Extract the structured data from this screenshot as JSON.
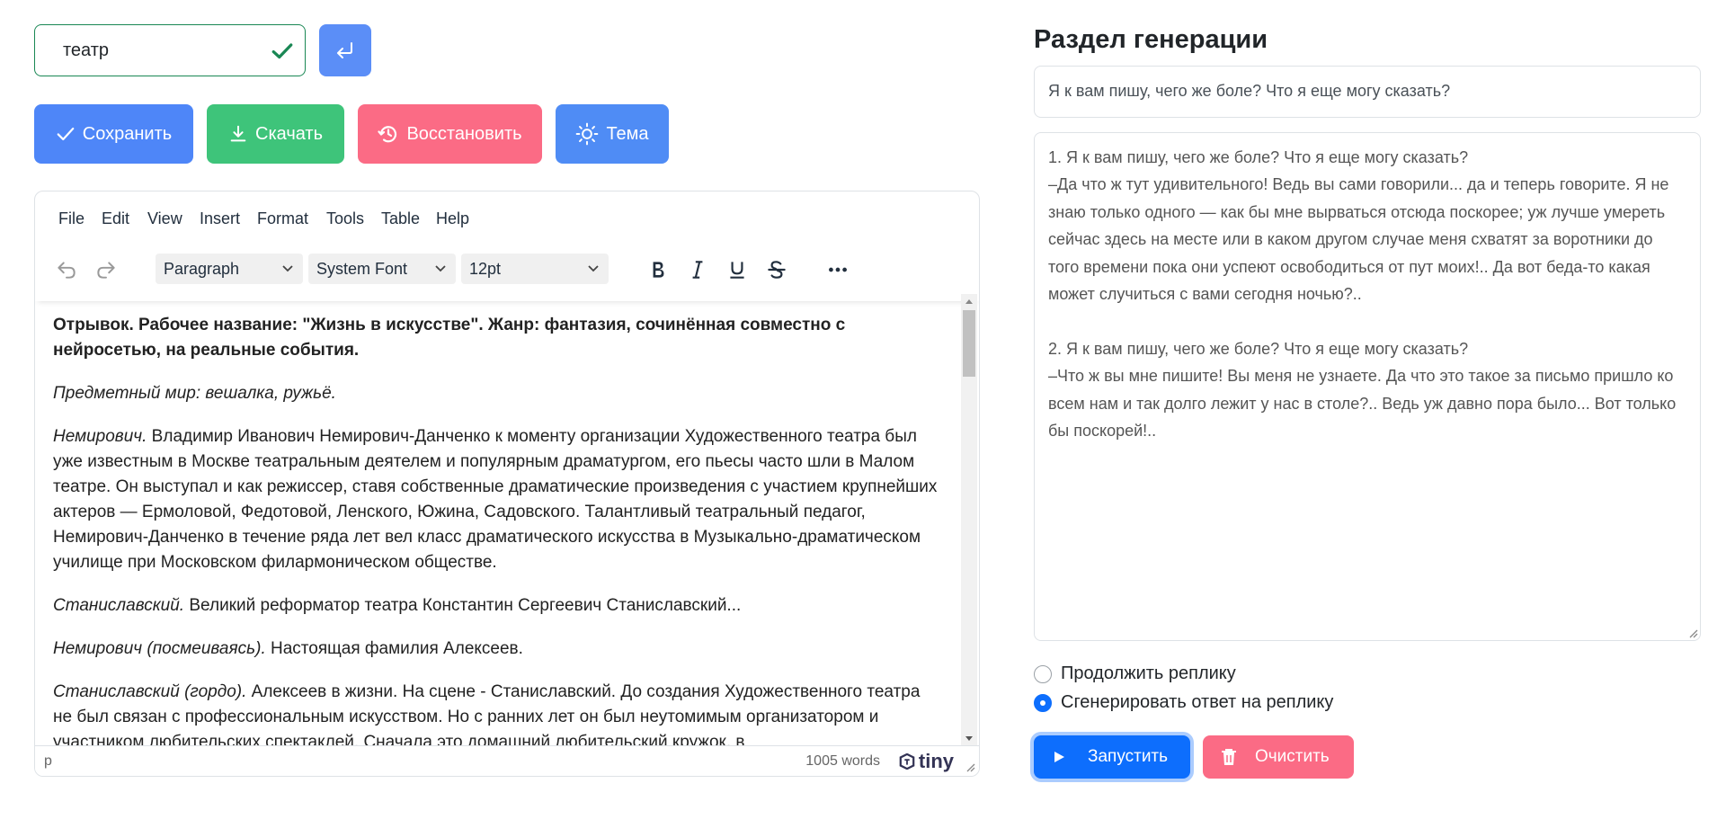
{
  "search": {
    "value": "театр"
  },
  "toolbar": {
    "save_label": "Сохранить",
    "download_label": "Скачать",
    "restore_label": "Восстановить",
    "theme_label": "Тема"
  },
  "editor": {
    "menu": [
      "File",
      "Edit",
      "View",
      "Insert",
      "Format",
      "Tools",
      "Table",
      "Help"
    ],
    "block_format": "Paragraph",
    "font_family": "System Font",
    "font_size": "12pt",
    "content": {
      "heading": "Отрывок. Рабочее название: \"Жизнь в искусстве\". Жанр: фантазия, сочинённая совместно с нейросетью, на реальные события.",
      "p1": "Предметный мир: вешалка, ружьё.",
      "p2_speaker": "Немирович.",
      "p2_text": " Владимир Иванович Немирович-Данченко к моменту организации Художественного театра был уже известным в Москве театральным деятелем и популярным драматургом, его пьесы часто шли в Малом театре. Он выступал и как режиссер, ставя собственные драматические произведения с участием крупнейших актеров — Ермоловой, Федотовой, Ленского, Южина, Садовского. Талантливый театральный педагог, Немирович-Данченко в течение ряда лет вел класс драматического искусства в Музыкально-драматическом училище при Московском филармоническом обществе.",
      "p3_speaker": "Станиславский.",
      "p3_text": " Великий реформатор театра Константин Сергеевич Станиславский...",
      "p4_speaker": "Немирович (посмеиваясь).",
      "p4_text": " Настоящая фамилия Алексеев.",
      "p5_speaker": "Станиславский (гордо).",
      "p5_text": " Алексеев в жизни. На сцене - Станиславский. До создания Художественного театра не был связан с профессиональным искусством. Но с ранних лет он был неутомимым организатором и участником любительских спектаклей. Сначала это домашний любительский кружок, в"
    },
    "status": {
      "path": "p",
      "word_count": "1005 words",
      "brand": "tiny"
    }
  },
  "generation": {
    "title": "Раздел генерации",
    "prompt": "Я к вам пишу, чего же боле? Что я еще могу сказать?",
    "output": "1. Я к вам пишу, чего же боле? Что я еще могу сказать?\n–Да что ж тут удивительного! Ведь вы сами говорили... да и теперь говорите. Я не знаю только одного — как бы мне вырваться отсюда поскорее; уж лучше умереть сейчас здесь на месте или в каком другом случае меня схватят за воротники до того времени пока они успеют освободиться от пут моих!.. Да вот беда-то какая может случиться с вами сегодня ночью?..\n\n2. Я к вам пишу, чего же боле? Что я еще могу сказать?\n–Что ж вы мне пишите! Вы меня не узнаете. Да что это такое за письмо пришло ко всем нам и так долго лежит у нас в столе?.. Ведь уж давно пора было... Вот только бы поскорей!..",
    "options": [
      {
        "label": "Продолжить реплику",
        "checked": false
      },
      {
        "label": "Сгенерировать ответ на реплику",
        "checked": true
      }
    ],
    "run_label": "Запустить",
    "clear_label": "Очистить"
  },
  "colors": {
    "primary": "#0d6efd",
    "save": "#4e86f8",
    "download": "#3ec47a",
    "restore": "#fb6b85",
    "theme": "#4f8cf5",
    "valid": "#198754"
  }
}
